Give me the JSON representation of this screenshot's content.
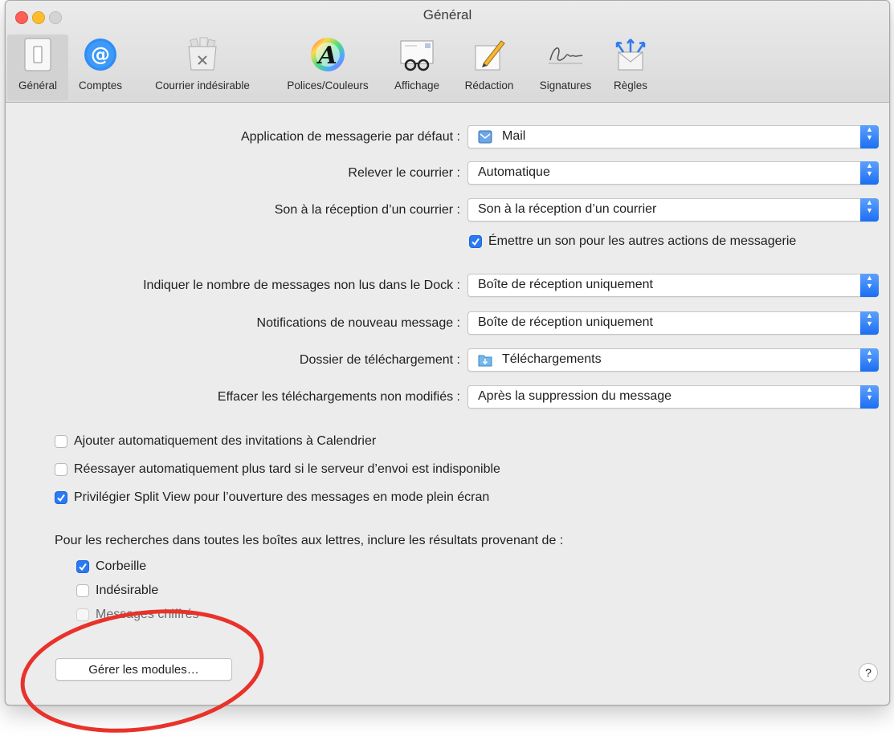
{
  "window": {
    "title": "Général"
  },
  "toolbar": {
    "items": [
      {
        "label": "Général",
        "icon": "general-switch-icon",
        "selected": true
      },
      {
        "label": "Comptes",
        "icon": "at-sign-icon"
      },
      {
        "label": "Courrier indésirable",
        "icon": "junk-trash-icon"
      },
      {
        "label": "Polices/Couleurs",
        "icon": "font-color-wheel-icon"
      },
      {
        "label": "Affichage",
        "icon": "glasses-envelope-icon"
      },
      {
        "label": "Rédaction",
        "icon": "pencil-note-icon"
      },
      {
        "label": "Signatures",
        "icon": "signature-icon"
      },
      {
        "label": "Règles",
        "icon": "rules-envelope-icon"
      }
    ]
  },
  "settings": {
    "default_app": {
      "label": "Application de messagerie par défaut :",
      "value": "Mail",
      "icon": "mail-app-icon"
    },
    "check_mail": {
      "label": "Relever le courrier :",
      "value": "Automatique"
    },
    "new_mail_sound": {
      "label": "Son à la réception d’un courrier :",
      "value": "Son à la réception d’un courrier"
    },
    "play_sounds": {
      "label": "Émettre un son pour les autres actions de messagerie",
      "checked": true
    },
    "dock_unread": {
      "label": "Indiquer le nombre de messages non lus dans le Dock :",
      "value": "Boîte de réception uniquement"
    },
    "new_notifications": {
      "label": "Notifications de nouveau message :",
      "value": "Boîte de réception uniquement"
    },
    "downloads_folder": {
      "label": "Dossier de téléchargement :",
      "value": "Téléchargements",
      "icon": "downloads-folder-icon"
    },
    "remove_downloads": {
      "label": "Effacer les téléchargements non modifiés :",
      "value": "Après la suppression du message"
    }
  },
  "checkboxes": {
    "add_invitations": {
      "label": "Ajouter automatiquement des invitations à Calendrier",
      "checked": false
    },
    "retry_send": {
      "label": "Réessayer automatiquement plus tard si le serveur d’envoi est indisponible",
      "checked": false
    },
    "split_view": {
      "label": "Privilégier Split View pour l’ouverture des messages en mode plein écran",
      "checked": true
    }
  },
  "search": {
    "heading": "Pour les recherches dans toutes les boîtes aux lettres, inclure les résultats provenant de :",
    "trash": {
      "label": "Corbeille",
      "checked": true
    },
    "junk": {
      "label": "Indésirable",
      "checked": false
    },
    "encrypted": {
      "label": "Messages chiffrés",
      "checked": false
    }
  },
  "buttons": {
    "manage_plugins": "Gérer les modules…",
    "help": "?"
  },
  "colors": {
    "accent": "#2a79f5",
    "annotation": "#e8322a"
  }
}
